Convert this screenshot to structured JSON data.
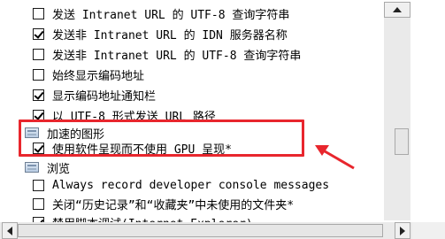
{
  "items": [
    {
      "kind": "checkbox",
      "checked": false,
      "label": "发送 Intranet URL 的 UTF-8 查询字符串"
    },
    {
      "kind": "checkbox",
      "checked": true,
      "label": "发送非 Intranet URL 的 IDN 服务器名称"
    },
    {
      "kind": "checkbox",
      "checked": false,
      "label": "发送非 Intranet URL 的 UTF-8 查询字符串"
    },
    {
      "kind": "checkbox",
      "checked": false,
      "label": "始终显示编码地址"
    },
    {
      "kind": "checkbox",
      "checked": true,
      "label": "显示编码地址通知栏"
    },
    {
      "kind": "checkbox",
      "checked": true,
      "label": "以 UTF-8 形式发送 URL 路径"
    },
    {
      "kind": "category",
      "label": "加速的图形"
    },
    {
      "kind": "checkbox",
      "checked": true,
      "label": "使用软件呈现而不使用 GPU 呈现*"
    },
    {
      "kind": "category",
      "label": "浏览"
    },
    {
      "kind": "checkbox",
      "checked": false,
      "label": "Always record developer console messages"
    },
    {
      "kind": "checkbox",
      "checked": false,
      "label": "关闭“历史记录”和“收藏夹”中未使用的文件夹*"
    },
    {
      "kind": "checkbox",
      "checked": true,
      "label": "禁用脚本调试(Internet Explorer)"
    }
  ],
  "colors": {
    "annotation": "#e8262d",
    "scrollbar": "#f0f0f0"
  },
  "icons": {
    "category": "settings-category-icon",
    "scroll_up": "scroll-up-arrow",
    "scroll_left": "scroll-left-arrow",
    "scroll_right": "scroll-right-arrow"
  }
}
